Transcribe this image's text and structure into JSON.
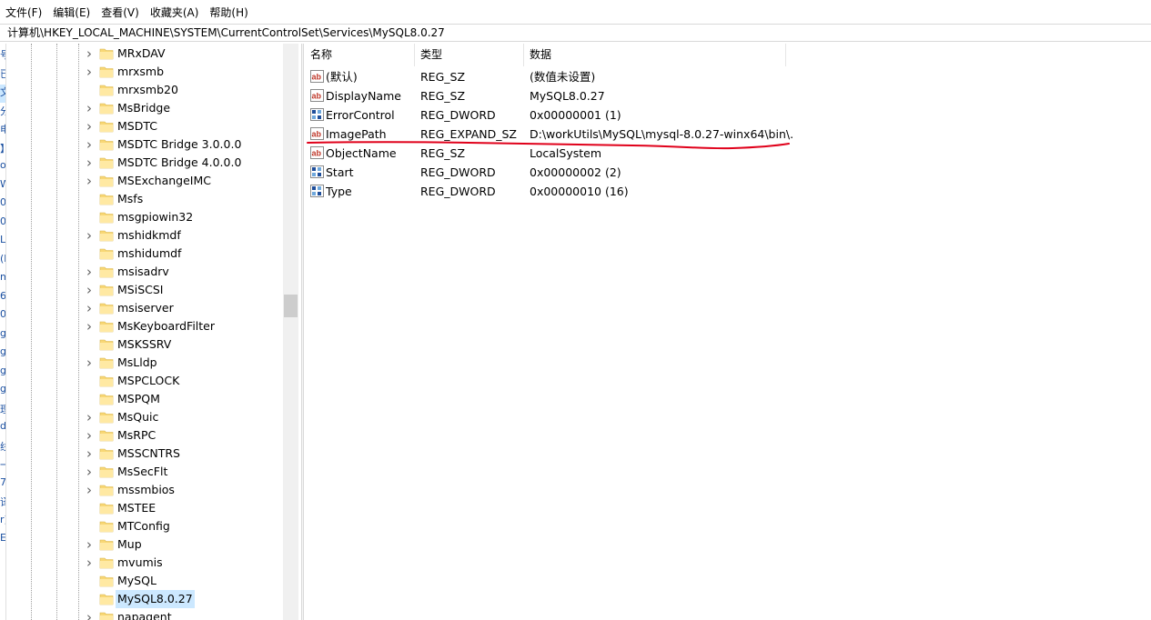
{
  "menu": [
    "文件(F)",
    "编辑(E)",
    "查看(V)",
    "收藏夹(A)",
    "帮助(H)"
  ],
  "address": "计算机\\HKEY_LOCAL_MACHINE\\SYSTEM\\CurrentControlSet\\Services\\MySQL8.0.27",
  "left_clip_glyphs": [
    "号",
    "已",
    "文",
    "分",
    "电",
    "】",
    "ox",
    "W",
    "0",
    "0",
    "Ll",
    "(l",
    "m",
    "6",
    "0",
    "g",
    "g",
    "g",
    "g",
    "理",
    "de",
    "线",
    "一",
    "7",
    "译",
    "r)",
    "E("
  ],
  "tree": [
    {
      "label": "MRxDAV",
      "expandable": true
    },
    {
      "label": "mrxsmb",
      "expandable": true
    },
    {
      "label": "mrxsmb20",
      "expandable": false
    },
    {
      "label": "MsBridge",
      "expandable": true
    },
    {
      "label": "MSDTC",
      "expandable": true
    },
    {
      "label": "MSDTC Bridge 3.0.0.0",
      "expandable": true
    },
    {
      "label": "MSDTC Bridge 4.0.0.0",
      "expandable": true
    },
    {
      "label": "MSExchangeIMC",
      "expandable": true
    },
    {
      "label": "Msfs",
      "expandable": false
    },
    {
      "label": "msgpiowin32",
      "expandable": false
    },
    {
      "label": "mshidkmdf",
      "expandable": true
    },
    {
      "label": "mshidumdf",
      "expandable": false
    },
    {
      "label": "msisadrv",
      "expandable": true
    },
    {
      "label": "MSiSCSI",
      "expandable": true
    },
    {
      "label": "msiserver",
      "expandable": true
    },
    {
      "label": "MsKeyboardFilter",
      "expandable": true
    },
    {
      "label": "MSKSSRV",
      "expandable": false
    },
    {
      "label": "MsLldp",
      "expandable": true
    },
    {
      "label": "MSPCLOCK",
      "expandable": false
    },
    {
      "label": "MSPQM",
      "expandable": false
    },
    {
      "label": "MsQuic",
      "expandable": true
    },
    {
      "label": "MsRPC",
      "expandable": true
    },
    {
      "label": "MSSCNTRS",
      "expandable": true
    },
    {
      "label": "MsSecFlt",
      "expandable": true
    },
    {
      "label": "mssmbios",
      "expandable": true
    },
    {
      "label": "MSTEE",
      "expandable": false
    },
    {
      "label": "MTConfig",
      "expandable": false
    },
    {
      "label": "Mup",
      "expandable": true
    },
    {
      "label": "mvumis",
      "expandable": true
    },
    {
      "label": "MySQL",
      "expandable": false
    },
    {
      "label": "MySQL8.0.27",
      "expandable": false,
      "selected": true
    },
    {
      "label": "napagent",
      "expandable": true
    }
  ],
  "columns": {
    "name": "名称",
    "type": "类型",
    "data": "数据"
  },
  "values": [
    {
      "name": "(默认)",
      "type": "REG_SZ",
      "data": "(数值未设置)",
      "icon": "string-value-icon"
    },
    {
      "name": "DisplayName",
      "type": "REG_SZ",
      "data": "MySQL8.0.27",
      "icon": "string-value-icon"
    },
    {
      "name": "ErrorControl",
      "type": "REG_DWORD",
      "data": "0x00000001 (1)",
      "icon": "binary-value-icon"
    },
    {
      "name": "ImagePath",
      "type": "REG_EXPAND_SZ",
      "data": "D:\\workUtils\\MySQL\\mysql-8.0.27-winx64\\bin\\...",
      "icon": "string-value-icon"
    },
    {
      "name": "ObjectName",
      "type": "REG_SZ",
      "data": "LocalSystem",
      "icon": "string-value-icon"
    },
    {
      "name": "Start",
      "type": "REG_DWORD",
      "data": "0x00000002 (2)",
      "icon": "binary-value-icon"
    },
    {
      "name": "Type",
      "type": "REG_DWORD",
      "data": "0x00000010 (16)",
      "icon": "binary-value-icon"
    }
  ],
  "colors": {
    "selection": "#cce8ff",
    "annotation": "#e0001a",
    "folder": "#f8d775",
    "string_icon": "#c0392b",
    "binary_icon": "#1f4e9a"
  }
}
